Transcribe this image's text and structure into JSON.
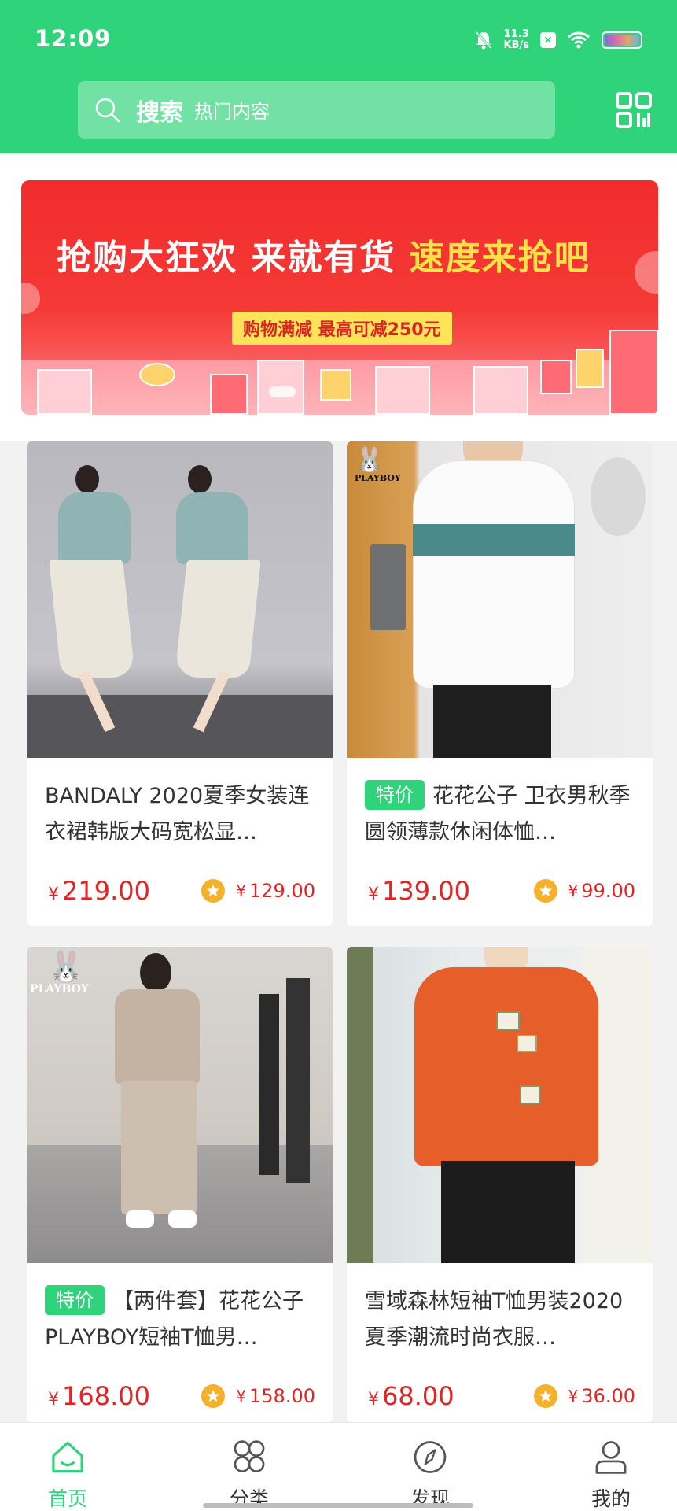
{
  "status_bar": {
    "time": "12:09",
    "net_speed_value": "11.3",
    "net_speed_unit": "KB/s",
    "icons": [
      "mute-bell-icon",
      "x-badge-icon",
      "wifi-icon",
      "battery-icon"
    ]
  },
  "search": {
    "label": "搜索",
    "placeholder": "热门内容"
  },
  "banner": {
    "headline_part1": "抢购大狂欢 来就有货",
    "headline_part2": "速度来抢吧",
    "subtitle": "购物满减 最高可减250元"
  },
  "products": [
    {
      "badge": "",
      "title": "BANDALY 2020夏季女装连衣裙韩版大码宽松显…",
      "price_symbol": "¥",
      "price": "219.00",
      "member_price": "129.00"
    },
    {
      "badge": "特价",
      "title": "花花公子 卫衣男秋季圆领薄款休闲体恤…",
      "price_symbol": "¥",
      "price": "139.00",
      "member_price": "99.00",
      "brand_mark": "PLAYBOY"
    },
    {
      "badge": "特价",
      "title": "【两件套】花花公子PLAYBOY短袖T恤男…",
      "price_symbol": "¥",
      "price": "168.00",
      "member_price": "158.00",
      "brand_mark": "PLAYBOY"
    },
    {
      "badge": "",
      "title": "雪域森林短袖T恤男装2020夏季潮流时尚衣服…",
      "price_symbol": "¥",
      "price": "68.00",
      "member_price": "36.00"
    }
  ],
  "bottom_nav": {
    "items": [
      {
        "label": "首页",
        "icon": "home-icon",
        "active": true
      },
      {
        "label": "分类",
        "icon": "category-icon",
        "active": false
      },
      {
        "label": "发现",
        "icon": "compass-icon",
        "active": false
      },
      {
        "label": "我的",
        "icon": "user-icon",
        "active": false
      }
    ]
  },
  "colors": {
    "brand_green": "#2ed37a",
    "price_red": "#e62323",
    "member_star": "#f6b12c"
  }
}
